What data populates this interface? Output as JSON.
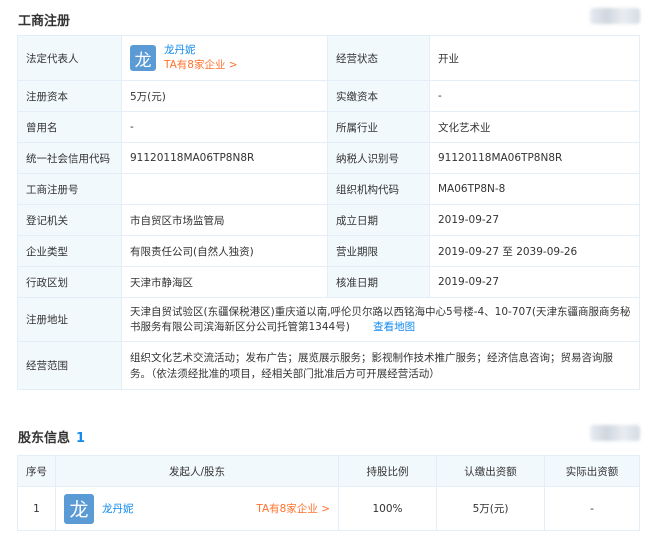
{
  "registration": {
    "title": "工商注册",
    "rows": {
      "legal_rep_label": "法定代表人",
      "legal_rep_logo": "龙",
      "legal_rep_name": "龙丹妮",
      "legal_rep_companies": "TA有8家企业 >",
      "status_label": "经营状态",
      "status_value": "开业",
      "reg_capital_label": "注册资本",
      "reg_capital_value": "5万(元)",
      "paid_capital_label": "实缴资本",
      "paid_capital_value": "-",
      "former_name_label": "曾用名",
      "former_name_value": "-",
      "industry_label": "所属行业",
      "industry_value": "文化艺术业",
      "credit_code_label": "统一社会信用代码",
      "credit_code_value": "91120118MA06TP8N8R",
      "taxpayer_id_label": "纳税人识别号",
      "taxpayer_id_value": "91120118MA06TP8N8R",
      "reg_no_label": "工商注册号",
      "reg_no_value": "",
      "org_code_label": "组织机构代码",
      "org_code_value": "MA06TP8N-8",
      "authority_label": "登记机关",
      "authority_value": "市自贸区市场监管局",
      "founded_label": "成立日期",
      "founded_value": "2019-09-27",
      "type_label": "企业类型",
      "type_value": "有限责任公司(自然人独资)",
      "term_label": "营业期限",
      "term_value": "2019-09-27 至 2039-09-26",
      "region_label": "行政区划",
      "region_value": "天津市静海区",
      "approval_label": "核准日期",
      "approval_value": "2019-09-27",
      "address_label": "注册地址",
      "address_value": "天津自贸试验区(东疆保税港区)重庆道以南,呼伦贝尔路以西铭海中心5号楼-4、10-707(天津东疆商服商务秘书服务有限公司滨海新区分公司托管第1344号)",
      "map_link": "查看地图",
      "scope_label": "经营范围",
      "scope_value": "组织文化艺术交流活动；发布广告；展览展示服务；影视制作技术推广服务；经济信息咨询；贸易咨询服务。（依法须经批准的项目，经相关部门批准后方可开展经营活动）"
    }
  },
  "shareholders": {
    "title": "股东信息",
    "count": "1",
    "headers": [
      "序号",
      "发起人/股东",
      "持股比例",
      "认缴出资额",
      "实际出资额"
    ],
    "rows": [
      {
        "index": "1",
        "logo": "龙",
        "name": "龙丹妮",
        "companies": "TA有8家企业 >",
        "ratio": "100%",
        "subscribed": "5万(元)",
        "paid": "-"
      }
    ]
  },
  "colors": {
    "accent": "#128bed",
    "label_bg": "#f2f9fc",
    "border": "#e4eef6",
    "orange": "#ff722d",
    "logo_bg": "#5b9bd5"
  }
}
